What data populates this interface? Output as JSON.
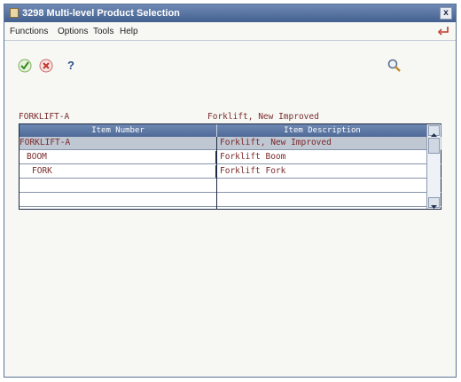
{
  "window": {
    "title": "3298  Multi-level Product Selection",
    "close_label": "x"
  },
  "menu": {
    "items": [
      "Functions",
      "Options",
      "Tools",
      "Help"
    ]
  },
  "toolbar": {
    "help_label": "?"
  },
  "header_fields": {
    "parent_item_number": "FORKLIFT-A",
    "parent_item_description": "Forklift, New Improved"
  },
  "grid": {
    "columns": [
      "Item Number",
      "Item Description"
    ],
    "rows": [
      {
        "number": "FORKLIFT-A",
        "description": "Forklift, New Improved"
      },
      {
        "number": "BOOM",
        "description": "Forklift Boom"
      },
      {
        "number": "FORK",
        "description": "Forklift Fork"
      },
      {
        "number": "",
        "description": ""
      },
      {
        "number": "",
        "description": ""
      }
    ]
  },
  "colors": {
    "title_bar": "#4f6a97",
    "field_text": "#7a2b2b",
    "window_bg": "#f7f8f4"
  }
}
